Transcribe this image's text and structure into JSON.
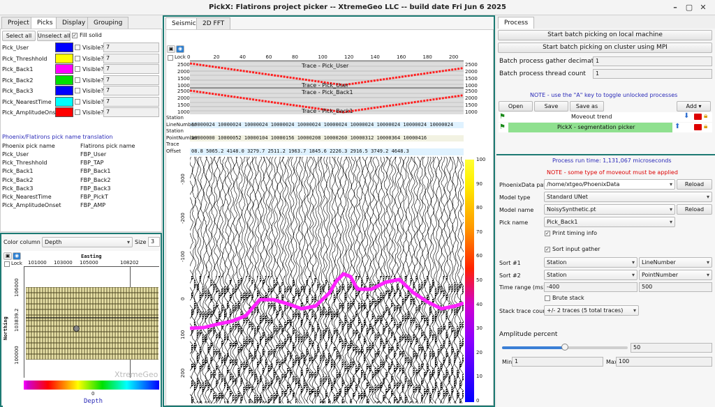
{
  "window": {
    "title": "PickX: Flatirons project picker -- XtremeGeo LLC -- build date Fri Jun 6 2025"
  },
  "left_tabs": [
    "Project",
    "Picks",
    "Display",
    "Grouping"
  ],
  "picks_toolbar": {
    "select_all": "Select all",
    "unselect_all": "Unselect all",
    "fill_solid": "Fill solid"
  },
  "picks": [
    {
      "name": "Pick_User",
      "color": "#0000ff",
      "visible_label": "Visible?",
      "value": "7"
    },
    {
      "name": "Pick_Threshhold",
      "color": "#ffff00",
      "visible_label": "Visible?",
      "value": "7"
    },
    {
      "name": "Pick_Back1",
      "color": "#ff00ff",
      "visible_label": "Visible?",
      "value": "7"
    },
    {
      "name": "Pick_Back2",
      "color": "#00e000",
      "visible_label": "Visible?",
      "value": "7"
    },
    {
      "name": "Pick_Back3",
      "color": "#0000ff",
      "visible_label": "Visible?",
      "value": "7"
    },
    {
      "name": "Pick_NearestTime",
      "color": "#00ffff",
      "visible_label": "Visible?",
      "value": "7"
    },
    {
      "name": "Pick_AmplitudeOnset",
      "color": "#ff0000",
      "visible_label": "Visible?",
      "value": "7"
    }
  ],
  "translation": {
    "title": "Phoenix/Flatirons pick name translation",
    "head_left": "Phoenix pick name",
    "head_right": "Flatirons pick name",
    "rows": [
      [
        "Pick_User",
        "FBP_User"
      ],
      [
        "Pick_Threshhold",
        "FBP_TAP"
      ],
      [
        "Pick_Back1",
        "FBP_Back1"
      ],
      [
        "Pick_Back2",
        "FBP_Back2"
      ],
      [
        "Pick_Back3",
        "FBP_Back3"
      ],
      [
        "Pick_NearestTime",
        "FBP_PickT"
      ],
      [
        "Pick_AmplitudeOnset",
        "FBP_AMP"
      ]
    ]
  },
  "map": {
    "color_column_label": "Color column",
    "color_column_value": "Depth",
    "size_label": "Size",
    "size_value": "3",
    "lock_label": "Lock",
    "easting_label": "Easting",
    "easting_ticks": [
      "101000",
      "103000",
      "105000",
      "108202"
    ],
    "northing_label": "Northing",
    "northing_ticks": [
      "106000",
      "103839.2",
      "100000"
    ],
    "colorbar_tick": "0",
    "colorbar_label": "Depth",
    "watermark": "XtremeGeo"
  },
  "center_tabs": [
    "Seismic",
    "2D FFT"
  ],
  "seismic": {
    "lock_label": "Lock",
    "trace_ticks": [
      "0",
      "20",
      "40",
      "60",
      "80",
      "100",
      "120",
      "140",
      "160",
      "180",
      "200"
    ],
    "hdr_ticks": [
      "2500",
      "2000",
      "1500",
      "1000"
    ],
    "panel1_title": "Trace - Pick_User",
    "panel1_title2": "Trace - Pick_User",
    "panel2_title": "Trace - Pick_Back1",
    "panel2_title2": "Trace - Pick_Back1",
    "header_rows": [
      {
        "label": "Station",
        "values": ""
      },
      {
        "label": "LineNumber",
        "values": "10000024   10000024   10000024   10000024   10000024   10000024   10000024   10000024   10000024   10000024"
      },
      {
        "label": "Station",
        "values": ""
      },
      {
        "label": "PointNumber",
        "values": "10000000   10000052   10000104   10000156   10000208   10000260   10000312   10000364   10000416"
      },
      {
        "label": "Trace",
        "values": ""
      },
      {
        "label": "Offset",
        "values": "08.8   5065.2   4148.0   3279.7   2511.2   1963.7   1845.6   2226.3   2916.5   3749.2   4648.3"
      }
    ],
    "time_ticks": [
      "-300",
      "-200",
      "-100",
      "0",
      "100",
      "200"
    ],
    "colorbar_ticks": [
      "100",
      "90",
      "80",
      "70",
      "60",
      "50",
      "40",
      "30",
      "20",
      "10",
      "0"
    ]
  },
  "right_tabs": [
    "Process"
  ],
  "process": {
    "btn_local": "Start batch picking on local machine",
    "btn_mpi": "Start batch picking on cluster using MPI",
    "decimation_label": "Batch process gather decimation",
    "decimation_value": "1",
    "threads_label": "Batch process thread count",
    "threads_value": "1",
    "note": "NOTE - use the \"A\" key to toggle unlocked processes",
    "open": "Open",
    "save": "Save",
    "save_as": "Save as",
    "add": "Add",
    "processes": [
      "Moveout trend",
      "PickX - segmentation picker"
    ],
    "runtime": "Process run time: 1,131,067 microseconds",
    "note_moveout": "NOTE - some type of moveout must be applied",
    "data_path_label": "PhoenixData path",
    "data_path": "/home/xtgeo/PhoenixData",
    "reload": "Reload",
    "model_type_label": "Model type",
    "model_type": "Standard UNet",
    "model_name_label": "Model name",
    "model_name": "NoisySynthetic.pt",
    "pick_name_label": "Pick name",
    "pick_name": "Pick_Back1",
    "print_timing": "Print timing info",
    "sort_input": "Sort input gather",
    "sort1_label": "Sort #1",
    "sort1_a": "Station",
    "sort1_b": "LineNumber",
    "sort2_label": "Sort #2",
    "sort2_a": "Station",
    "sort2_b": "PointNumber",
    "time_range_label": "Time range (ms)",
    "time_min": "-400",
    "time_max": "500",
    "brute_stack": "Brute stack",
    "stack_count_label": "Stack trace count",
    "stack_count": "+/- 2 traces (5 total traces)",
    "amp_title": "Amplitude percent",
    "amp_value": "50",
    "amp_fraction": 0.5,
    "min_label": "Min",
    "min_value": "1",
    "max_label": "Max",
    "max_value": "100"
  }
}
